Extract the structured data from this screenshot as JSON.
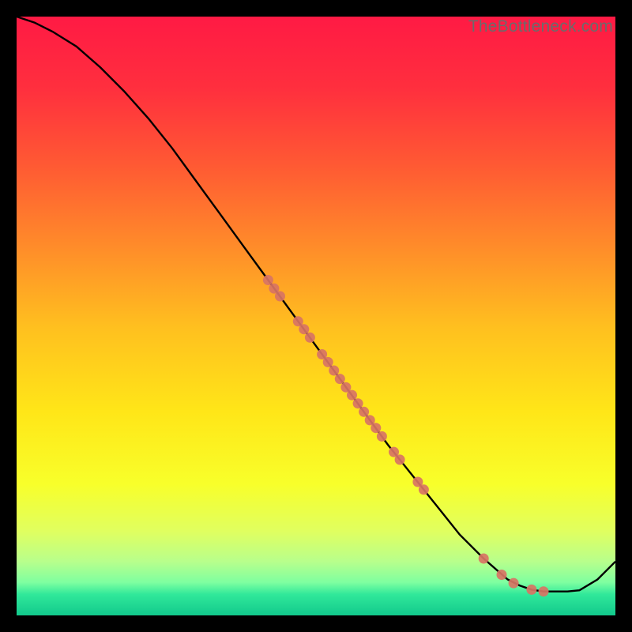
{
  "watermark": "TheBottleneck.com",
  "chart_data": {
    "type": "line",
    "title": "",
    "xlabel": "",
    "ylabel": "",
    "xlim": [
      0,
      100
    ],
    "ylim": [
      0,
      100
    ],
    "grid": false,
    "series": [
      {
        "name": "curve",
        "color": "#000000",
        "x": [
          0,
          3,
          6,
          10,
          14,
          18,
          22,
          26,
          30,
          34,
          38,
          42,
          46,
          50,
          54,
          58,
          62,
          66,
          70,
          74,
          78,
          82,
          84,
          86,
          88,
          90,
          92,
          94,
          97,
          100
        ],
        "y": [
          100,
          99,
          97.5,
          95,
          91.5,
          87.5,
          83,
          78,
          72.5,
          67,
          61.5,
          56,
          50.5,
          45,
          39.5,
          34,
          28.5,
          23.5,
          18.5,
          13.5,
          9.5,
          6.0,
          5.0,
          4.3,
          4.0,
          4.0,
          4.0,
          4.2,
          6.0,
          9.0
        ]
      }
    ],
    "points": {
      "name": "markers",
      "color": "#d87464",
      "x": [
        42,
        43,
        44,
        47,
        48,
        49,
        51,
        52,
        53,
        54,
        55,
        56,
        57,
        58,
        59,
        60,
        61,
        63,
        64,
        67,
        68,
        78,
        81,
        83,
        86,
        88
      ],
      "y": [
        56.0,
        54.6,
        53.3,
        49.1,
        47.8,
        46.4,
        43.6,
        42.3,
        40.9,
        39.5,
        38.1,
        36.8,
        35.4,
        34.0,
        32.6,
        31.3,
        29.9,
        27.3,
        26.0,
        22.3,
        21.0,
        9.5,
        6.8,
        5.4,
        4.3,
        4.0
      ]
    },
    "gradient_stops": [
      {
        "offset": 0.0,
        "color": "#ff1a44"
      },
      {
        "offset": 0.12,
        "color": "#ff2f3e"
      },
      {
        "offset": 0.25,
        "color": "#ff5a33"
      },
      {
        "offset": 0.38,
        "color": "#ff8a2a"
      },
      {
        "offset": 0.52,
        "color": "#ffc01f"
      },
      {
        "offset": 0.66,
        "color": "#ffe618"
      },
      {
        "offset": 0.78,
        "color": "#f8ff2a"
      },
      {
        "offset": 0.86,
        "color": "#e0ff60"
      },
      {
        "offset": 0.91,
        "color": "#b8ff8c"
      },
      {
        "offset": 0.945,
        "color": "#7effa0"
      },
      {
        "offset": 0.965,
        "color": "#30e89a"
      },
      {
        "offset": 1.0,
        "color": "#12c98c"
      }
    ]
  }
}
